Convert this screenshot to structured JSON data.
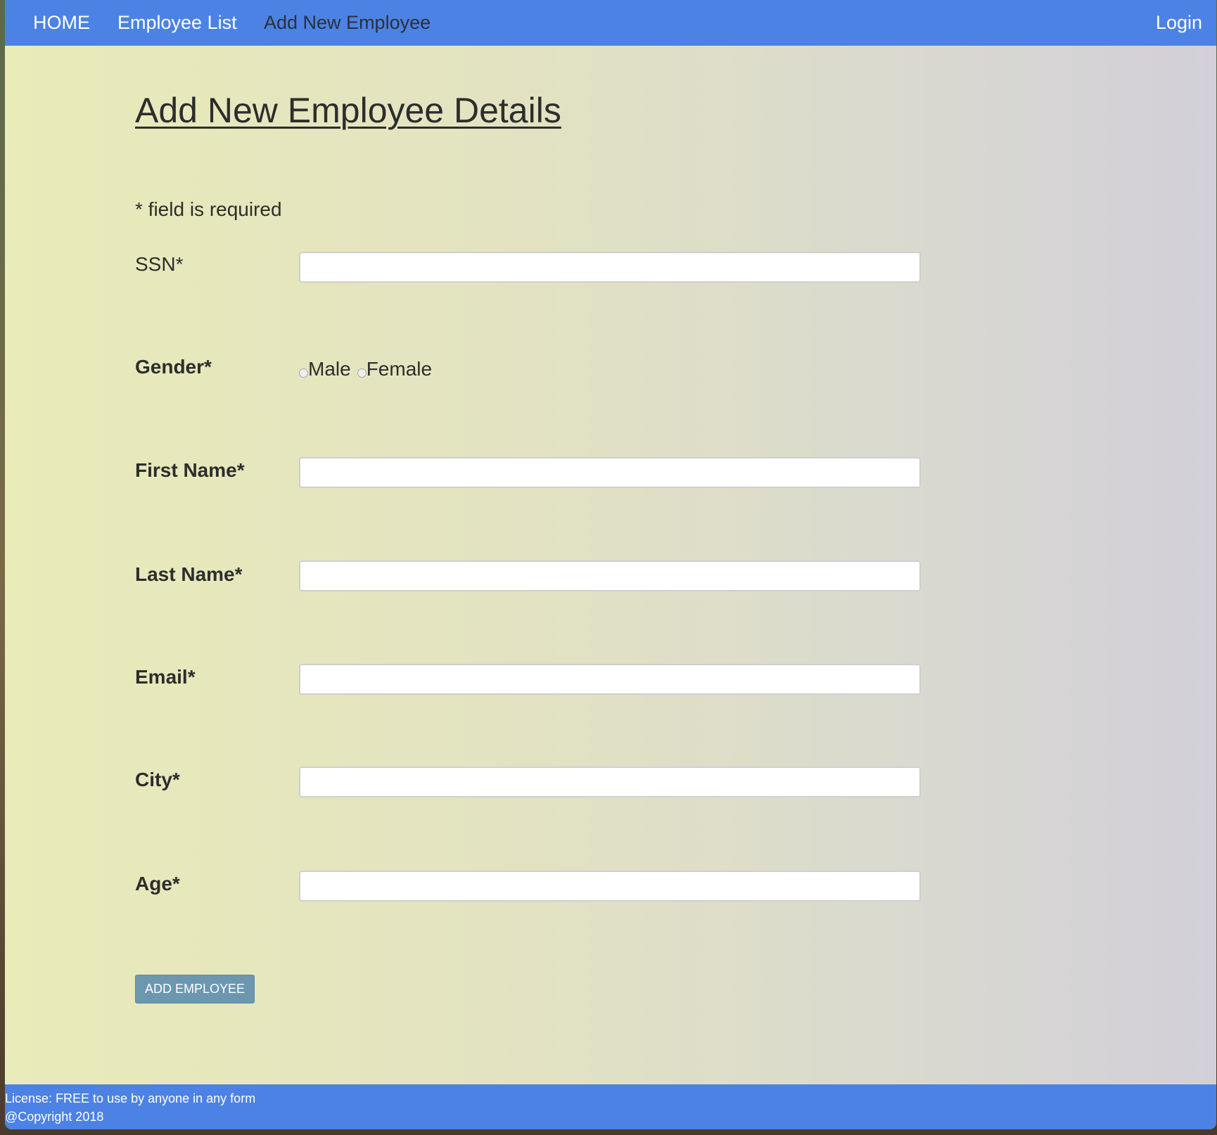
{
  "navbar": {
    "items": [
      {
        "label": "HOME"
      },
      {
        "label": "Employee List"
      },
      {
        "label": "Add New Employee"
      }
    ],
    "login_label": "Login"
  },
  "page": {
    "title": "Add New Employee Details",
    "required_note": "* field is required"
  },
  "form": {
    "ssn": {
      "label": "SSN*",
      "value": ""
    },
    "gender": {
      "label": "Gender*",
      "options": [
        {
          "label": "Male",
          "checked": false
        },
        {
          "label": "Female",
          "checked": false
        }
      ]
    },
    "first_name": {
      "label": "First Name*",
      "value": ""
    },
    "last_name": {
      "label": "Last Name*",
      "value": ""
    },
    "email": {
      "label": "Email*",
      "value": ""
    },
    "city": {
      "label": "City*",
      "value": ""
    },
    "age": {
      "label": "Age*",
      "value": ""
    },
    "submit_label": "ADD EMPLOYEE"
  },
  "footer": {
    "license": "License: FREE to use by anyone in any form",
    "copyright": "@Copyright 2018"
  },
  "colors": {
    "navbar": "#4c82e3",
    "footer": "#4c82e3",
    "button": "#6b97b1"
  }
}
